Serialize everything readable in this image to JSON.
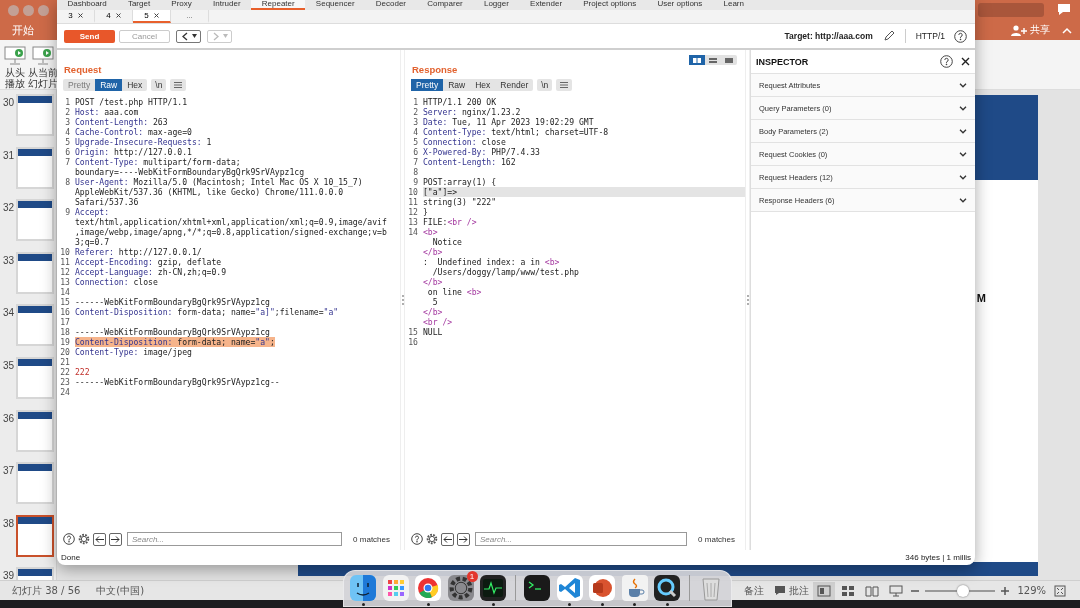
{
  "presentation": {
    "ribbon_tab": "开始",
    "share_button": "共享",
    "ribbon_buttons": [
      "从头播放",
      "从当前幻灯片"
    ],
    "slides": [
      {
        "number": "30",
        "selected": false
      },
      {
        "number": "31",
        "selected": false
      },
      {
        "number": "32",
        "selected": false
      },
      {
        "number": "33",
        "selected": false
      },
      {
        "number": "34",
        "selected": false
      },
      {
        "number": "35",
        "selected": false
      },
      {
        "number": "36",
        "selected": false
      },
      {
        "number": "37",
        "selected": false
      },
      {
        "number": "38",
        "selected": true
      },
      {
        "number": "39",
        "selected": false
      }
    ],
    "slide_text": "M",
    "status": {
      "slide_counter": "幻灯片 38 / 56",
      "language": "中文(中国)",
      "notes": "备注",
      "comments": "批注",
      "views": [
        {
          "kind": "normal",
          "selected": true
        },
        {
          "kind": "sorter",
          "selected": false
        },
        {
          "kind": "reading",
          "selected": false
        },
        {
          "kind": "slideshow",
          "selected": false
        }
      ],
      "zoom": {
        "level": 0.54,
        "reading": "129%"
      }
    }
  },
  "burp": {
    "tabs": [
      {
        "label": "Dashboard",
        "selected": false
      },
      {
        "label": "Target",
        "selected": false
      },
      {
        "label": "Proxy",
        "selected": false
      },
      {
        "label": "Intruder",
        "selected": false
      },
      {
        "label": "Repeater",
        "selected": true
      },
      {
        "label": "Sequencer",
        "selected": false
      },
      {
        "label": "Decoder",
        "selected": false
      },
      {
        "label": "Comparer",
        "selected": false
      },
      {
        "label": "Logger",
        "selected": false
      },
      {
        "label": "Extender",
        "selected": false
      },
      {
        "label": "Project options",
        "selected": false
      },
      {
        "label": "User options",
        "selected": false
      },
      {
        "label": "Learn",
        "selected": false
      }
    ],
    "repeater_tabs": [
      {
        "label": "3",
        "selected": false
      },
      {
        "label": "4",
        "selected": false
      },
      {
        "label": "5",
        "selected": true
      }
    ],
    "more_tabs": "...",
    "toolbar": {
      "send": "Send",
      "cancel": "Cancel",
      "history": [
        {
          "kind": "back",
          "disabled": false
        },
        {
          "kind": "forward",
          "disabled": true
        }
      ],
      "target": "Target: http://aaa.com",
      "protocol": "HTTP/1"
    },
    "request": {
      "title": "Request",
      "views": [
        {
          "label": "Pretty",
          "selected": false,
          "disabled": true
        },
        {
          "label": "Raw",
          "selected": true,
          "disabled": false
        },
        {
          "label": "Hex",
          "selected": false,
          "disabled": false
        }
      ],
      "newline_toggle": "\\n",
      "lines": [
        {
          "n": "1",
          "parts": [
            {
              "kind": "plain",
              "text": "POST /test.php HTTP/1.1"
            }
          ],
          "highlighted": false
        },
        {
          "n": "2",
          "parts": [
            {
              "kind": "name",
              "text": "Host:"
            },
            {
              "kind": "plain",
              "text": " aaa.com"
            }
          ],
          "highlighted": false
        },
        {
          "n": "3",
          "parts": [
            {
              "kind": "name",
              "text": "Content-Length:"
            },
            {
              "kind": "plain",
              "text": " 263"
            }
          ],
          "highlighted": false
        },
        {
          "n": "4",
          "parts": [
            {
              "kind": "name",
              "text": "Cache-Control:"
            },
            {
              "kind": "plain",
              "text": " max-age=0"
            }
          ],
          "highlighted": false
        },
        {
          "n": "5",
          "parts": [
            {
              "kind": "name",
              "text": "Upgrade-Insecure-Requests:"
            },
            {
              "kind": "plain",
              "text": " 1"
            }
          ],
          "highlighted": false
        },
        {
          "n": "6",
          "parts": [
            {
              "kind": "name",
              "text": "Origin:"
            },
            {
              "kind": "plain",
              "text": " http://127.0.0.1"
            }
          ],
          "highlighted": false
        },
        {
          "n": "7",
          "parts": [
            {
              "kind": "name",
              "text": "Content-Type:"
            },
            {
              "kind": "plain",
              "text": " multipart/form-data;"
            }
          ],
          "highlighted": false
        },
        {
          "parts": [
            {
              "kind": "plain",
              "text": "boundary=----WebKitFormBoundaryBgQrk9SrVAypz1cg"
            }
          ],
          "highlighted": false
        },
        {
          "n": "8",
          "parts": [
            {
              "kind": "name",
              "text": "User-Agent:"
            },
            {
              "kind": "plain",
              "text": " Mozilla/5.0 (Macintosh; Intel Mac OS X 10_15_7)"
            }
          ],
          "highlighted": false
        },
        {
          "parts": [
            {
              "kind": "plain",
              "text": "AppleWebKit/537.36 (KHTML, like Gecko) Chrome/111.0.0.0"
            }
          ],
          "highlighted": false
        },
        {
          "parts": [
            {
              "kind": "plain",
              "text": "Safari/537.36"
            }
          ],
          "highlighted": false
        },
        {
          "n": "9",
          "parts": [
            {
              "kind": "name",
              "text": "Accept:"
            }
          ],
          "highlighted": false
        },
        {
          "parts": [
            {
              "kind": "plain",
              "text": "text/html,application/xhtml+xml,application/xml;q=0.9,image/avif"
            }
          ],
          "highlighted": false
        },
        {
          "parts": [
            {
              "kind": "plain",
              "text": ",image/webp,image/apng,*/*;q=0.8,application/signed-exchange;v=b"
            }
          ],
          "highlighted": false
        },
        {
          "parts": [
            {
              "kind": "plain",
              "text": "3;q=0.7"
            }
          ],
          "highlighted": false
        },
        {
          "n": "10",
          "parts": [
            {
              "kind": "name",
              "text": "Referer:"
            },
            {
              "kind": "plain",
              "text": " http://127.0.0.1/"
            }
          ],
          "highlighted": false
        },
        {
          "n": "11",
          "parts": [
            {
              "kind": "name",
              "text": "Accept-Encoding:"
            },
            {
              "kind": "plain",
              "text": " gzip, deflate"
            }
          ],
          "highlighted": false
        },
        {
          "n": "12",
          "parts": [
            {
              "kind": "name",
              "text": "Accept-Language:"
            },
            {
              "kind": "plain",
              "text": " zh-CN,zh;q=0.9"
            }
          ],
          "highlighted": false
        },
        {
          "n": "13",
          "parts": [
            {
              "kind": "name",
              "text": "Connection:"
            },
            {
              "kind": "plain",
              "text": " close"
            }
          ],
          "highlighted": false
        },
        {
          "n": "14",
          "highlighted": false
        },
        {
          "n": "15",
          "parts": [
            {
              "kind": "plain",
              "text": "------WebKitFormBoundaryBgQrk9SrVAypz1cg"
            }
          ],
          "highlighted": false
        },
        {
          "n": "16",
          "parts": [
            {
              "kind": "name",
              "text": "Content-Disposition:"
            },
            {
              "kind": "plain",
              "text": " form-data; name="
            },
            {
              "kind": "string",
              "text": "\"a]\""
            },
            {
              "kind": "plain",
              "text": ";filename="
            },
            {
              "kind": "string",
              "text": "\"a\""
            }
          ],
          "highlighted": false
        },
        {
          "n": "17",
          "highlighted": false
        },
        {
          "n": "18",
          "parts": [
            {
              "kind": "plain",
              "text": "------WebKitFormBoundaryBgQrk9SrVAypz1cg"
            }
          ],
          "highlighted": false
        },
        {
          "n": "19",
          "parts": [
            {
              "kind": "name",
              "text": "Content-Disposition:"
            },
            {
              "kind": "plain",
              "text": " form-data; name="
            },
            {
              "kind": "string",
              "text": "\"a\""
            },
            {
              "kind": "plain",
              "text": ";"
            }
          ],
          "highlighted": true
        },
        {
          "n": "20",
          "parts": [
            {
              "kind": "name",
              "text": "Content-Type:"
            },
            {
              "kind": "plain",
              "text": " image/jpeg"
            }
          ],
          "highlighted": false
        },
        {
          "n": "21",
          "highlighted": false
        },
        {
          "n": "22",
          "parts": [
            {
              "kind": "number",
              "text": "222"
            }
          ],
          "highlighted": false
        },
        {
          "n": "23",
          "parts": [
            {
              "kind": "plain",
              "text": "------WebKitFormBoundaryBgQrk9SrVAypz1cg--"
            }
          ],
          "highlighted": false
        },
        {
          "n": "24",
          "highlighted": false
        }
      ],
      "search": {
        "placeholder": "Search...",
        "matches": "0 matches"
      }
    },
    "response": {
      "title": "Response",
      "layouts": [
        {
          "kind": "columns",
          "selected": true
        },
        {
          "kind": "rows",
          "selected": false
        },
        {
          "kind": "single",
          "selected": false
        }
      ],
      "views": [
        {
          "label": "Pretty",
          "selected": true,
          "disabled": false
        },
        {
          "label": "Raw",
          "selected": false,
          "disabled": false
        },
        {
          "label": "Hex",
          "selected": false,
          "disabled": false
        },
        {
          "label": "Render",
          "selected": false,
          "disabled": false
        }
      ],
      "newline_toggle": "\\n",
      "lines": [
        {
          "n": "1",
          "parts": [
            {
              "kind": "plain",
              "text": "HTTP/1.1 200 OK"
            }
          ],
          "highlighted": false
        },
        {
          "n": "2",
          "parts": [
            {
              "kind": "name",
              "text": "Server:"
            },
            {
              "kind": "plain",
              "text": " nginx/1.23.2"
            }
          ],
          "highlighted": false
        },
        {
          "n": "3",
          "parts": [
            {
              "kind": "name",
              "text": "Date:"
            },
            {
              "kind": "plain",
              "text": " Tue, 11 Apr 2023 19:02:29 GMT"
            }
          ],
          "highlighted": false
        },
        {
          "n": "4",
          "parts": [
            {
              "kind": "name",
              "text": "Content-Type:"
            },
            {
              "kind": "plain",
              "text": " text/html; charset=UTF-8"
            }
          ],
          "highlighted": false
        },
        {
          "n": "5",
          "parts": [
            {
              "kind": "name",
              "text": "Connection:"
            },
            {
              "kind": "plain",
              "text": " close"
            }
          ],
          "highlighted": false
        },
        {
          "n": "6",
          "parts": [
            {
              "kind": "name",
              "text": "X-Powered-By:"
            },
            {
              "kind": "plain",
              "text": " PHP/7.4.33"
            }
          ],
          "highlighted": false
        },
        {
          "n": "7",
          "parts": [
            {
              "kind": "name",
              "text": "Content-Length:"
            },
            {
              "kind": "plain",
              "text": " 162"
            }
          ],
          "highlighted": false
        },
        {
          "n": "8",
          "highlighted": false
        },
        {
          "n": "9",
          "parts": [
            {
              "kind": "plain",
              "text": "POST:array(1) {"
            }
          ],
          "highlighted": false
        },
        {
          "n": "10",
          "parts": [
            {
              "kind": "plain",
              "text": "[\"a\"]=>"
            }
          ],
          "highlighted": true
        },
        {
          "n": "11",
          "parts": [
            {
              "kind": "plain",
              "text": "string(3) \"222\""
            }
          ],
          "highlighted": false
        },
        {
          "n": "12",
          "parts": [
            {
              "kind": "plain",
              "text": "}"
            }
          ],
          "highlighted": false
        },
        {
          "n": "13",
          "parts": [
            {
              "kind": "plain",
              "text": "FILE:"
            },
            {
              "kind": "tag",
              "text": "<br />"
            }
          ],
          "highlighted": false
        },
        {
          "n": "14",
          "parts": [
            {
              "kind": "tag",
              "text": "<b>"
            }
          ],
          "highlighted": false
        },
        {
          "parts": [
            {
              "kind": "plain",
              "text": "  Notice"
            }
          ],
          "highlighted": false
        },
        {
          "parts": [
            {
              "kind": "tag",
              "text": "</b>"
            }
          ],
          "highlighted": false
        },
        {
          "parts": [
            {
              "kind": "plain",
              "text": ":  Undefined index: a in "
            },
            {
              "kind": "tag",
              "text": "<b>"
            }
          ],
          "highlighted": false
        },
        {
          "parts": [
            {
              "kind": "plain",
              "text": "  /Users/doggy/lamp/www/test.php"
            }
          ],
          "highlighted": false
        },
        {
          "parts": [
            {
              "kind": "tag",
              "text": "</b>"
            }
          ],
          "highlighted": false
        },
        {
          "parts": [
            {
              "kind": "plain",
              "text": " on line "
            },
            {
              "kind": "tag",
              "text": "<b>"
            }
          ],
          "highlighted": false
        },
        {
          "parts": [
            {
              "kind": "plain",
              "text": "  5"
            }
          ],
          "highlighted": false
        },
        {
          "parts": [
            {
              "kind": "tag",
              "text": "</b>"
            }
          ],
          "highlighted": false
        },
        {
          "parts": [
            {
              "kind": "tag",
              "text": "<br />"
            }
          ],
          "highlighted": false
        },
        {
          "n": "15",
          "parts": [
            {
              "kind": "plain",
              "text": "NULL"
            }
          ],
          "highlighted": false
        },
        {
          "n": "16",
          "highlighted": false
        }
      ],
      "search": {
        "placeholder": "Search...",
        "matches": "0 matches"
      }
    },
    "inspector": {
      "title": "INSPECTOR",
      "sections": [
        {
          "label": "Request Attributes",
          "expanded": false
        },
        {
          "label": "Query Parameters (0)",
          "expanded": false
        },
        {
          "label": "Body Parameters (2)",
          "expanded": false
        },
        {
          "label": "Request Cookies (0)",
          "expanded": false
        },
        {
          "label": "Request Headers (12)",
          "expanded": false
        },
        {
          "label": "Response Headers (6)",
          "expanded": false
        }
      ]
    },
    "status": {
      "message": "Done",
      "size": "346 bytes | 1 millis"
    }
  },
  "dock": {
    "apps": [
      {
        "kind": "finder",
        "running": true
      },
      {
        "kind": "launchpad",
        "running": false
      },
      {
        "kind": "browser",
        "running": true
      },
      {
        "kind": "settings",
        "running": false,
        "badge": "1"
      },
      {
        "kind": "monitor",
        "running": true
      },
      {
        "kind": "terminal",
        "running": false
      },
      {
        "kind": "editor",
        "running": true
      },
      {
        "kind": "slides",
        "running": true
      },
      {
        "kind": "java",
        "running": true
      },
      {
        "kind": "player",
        "running": true
      },
      {
        "kind": "trash",
        "running": false
      }
    ]
  }
}
